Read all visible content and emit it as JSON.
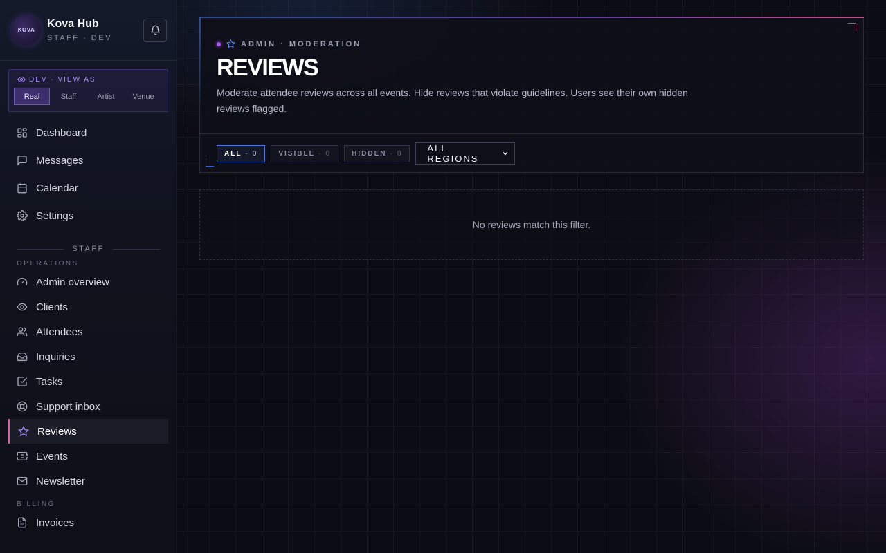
{
  "brand": {
    "name": "Kova Hub",
    "subtitle": "STAFF · DEV",
    "logo_text": "KOVA"
  },
  "view_as": {
    "label": "DEV · VIEW AS",
    "options": [
      "Real",
      "Staff",
      "Artist",
      "Venue"
    ],
    "selected": "Real"
  },
  "nav_primary": [
    {
      "label": "Dashboard",
      "icon": "dashboard-icon"
    },
    {
      "label": "Messages",
      "icon": "message-icon"
    },
    {
      "label": "Calendar",
      "icon": "calendar-icon"
    },
    {
      "label": "Settings",
      "icon": "gear-icon"
    }
  ],
  "staff_divider": "STAFF",
  "sections": {
    "operations": "OPERATIONS",
    "billing": "BILLING"
  },
  "nav_operations": [
    {
      "label": "Admin overview",
      "icon": "gauge-icon"
    },
    {
      "label": "Clients",
      "icon": "eye-icon"
    },
    {
      "label": "Attendees",
      "icon": "users-icon"
    },
    {
      "label": "Inquiries",
      "icon": "inbox-icon"
    },
    {
      "label": "Tasks",
      "icon": "checkbox-icon"
    },
    {
      "label": "Support inbox",
      "icon": "lifebuoy-icon"
    },
    {
      "label": "Reviews",
      "icon": "star-icon",
      "active": true
    },
    {
      "label": "Events",
      "icon": "ticket-icon"
    },
    {
      "label": "Newsletter",
      "icon": "mail-icon"
    }
  ],
  "nav_billing": [
    {
      "label": "Invoices",
      "icon": "document-icon"
    }
  ],
  "header": {
    "eyebrow": "ADMIN · MODERATION",
    "title": "REVIEWS",
    "description": "Moderate attendee reviews across all events. Hide reviews that violate guidelines. Users see their own hidden reviews flagged."
  },
  "filters": {
    "chips": [
      {
        "label": "ALL",
        "count": "0",
        "active": true
      },
      {
        "label": "VISIBLE",
        "count": "0",
        "active": false
      },
      {
        "label": "HIDDEN",
        "count": "0",
        "active": false
      }
    ],
    "region_select": "ALL REGIONS"
  },
  "empty_state": "No reviews match this filter.",
  "colors": {
    "accent_purple": "#a855f7",
    "accent_pink": "#e25fa8",
    "accent_blue": "#4e78d8"
  }
}
